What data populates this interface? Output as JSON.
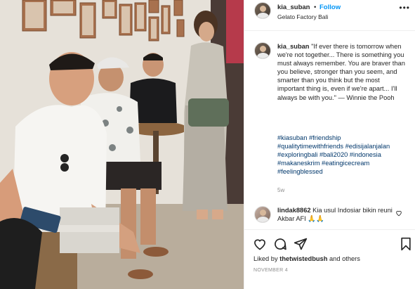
{
  "post": {
    "username": "kia_suban",
    "dot": "•",
    "follow_label": "Follow",
    "location": "Gelato Factory Bali",
    "more_label": "•••"
  },
  "caption": {
    "username": "kia_suban",
    "text": "\"If ever there is tomorrow when we're not together... There is something you must always remember. You are braver than you believe, stronger than you seem, and smarter than you think but the most important thing is, even if we're apart... I'll always be with you.\" — Winnie the Pooh",
    "hashtags": [
      "#kiasuban",
      "#friendship",
      "#qualitytimewithfriends",
      "#edisijalanjalan",
      "#exploringbali",
      "#bali2020",
      "#indonesia",
      "#makaneskrim",
      "#eatingicecream",
      "#feelingblessed"
    ],
    "age": "5w"
  },
  "comment": {
    "username": "lindak8862",
    "text": "Kia usul Indosiar bikin reuni Akbar AFI 🙏🙏"
  },
  "engagement": {
    "liked_by_prefix": "Liked by ",
    "liked_by_user": "thetwistedbush",
    "liked_by_suffix": " and others",
    "date": "NOVEMBER 4"
  },
  "icons": [
    "more-options-icon",
    "heart-icon",
    "comment-icon",
    "share-icon",
    "bookmark-icon"
  ],
  "colors": {
    "follow": "#0095f6",
    "hashtag": "#00376b",
    "muted": "#8e8e8e",
    "text": "#262626"
  }
}
